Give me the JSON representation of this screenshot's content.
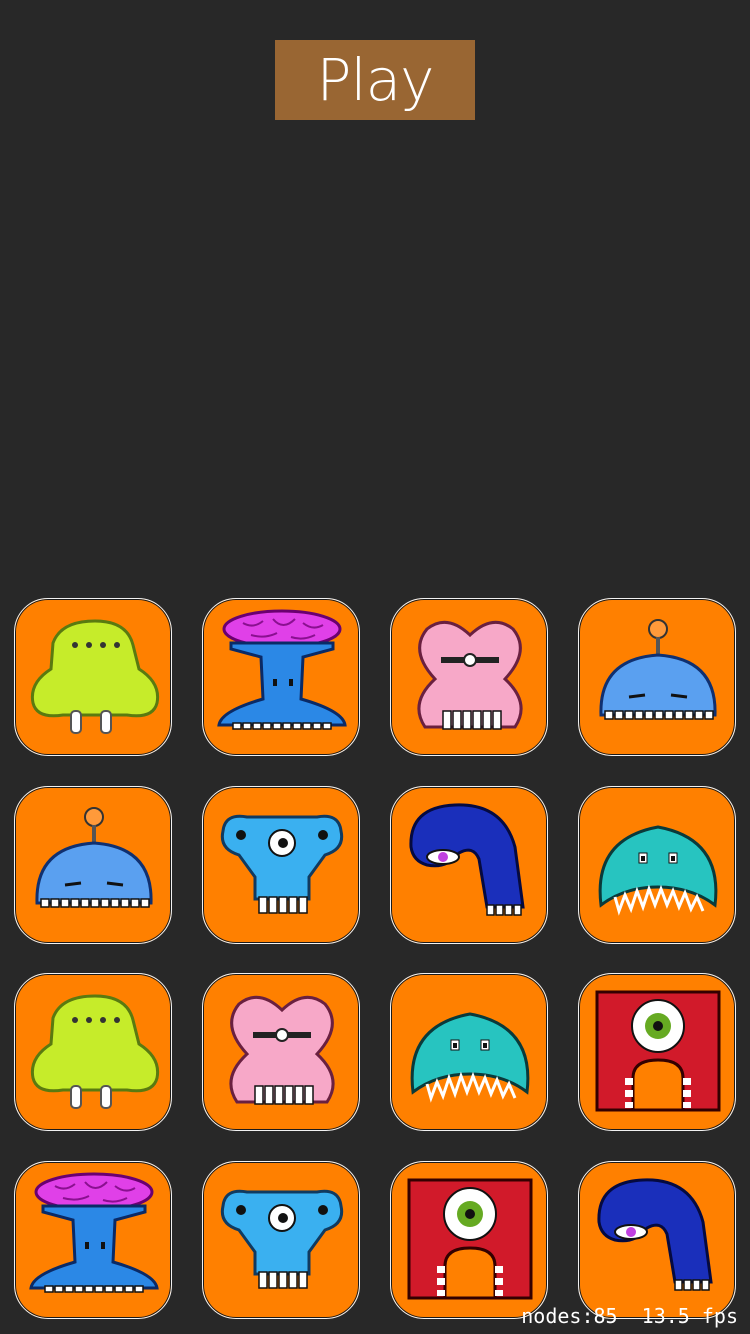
{
  "play_button": {
    "label": "Play"
  },
  "grid": {
    "rows": [
      [
        "green-monster",
        "brain-monster",
        "pink-monster",
        "robot-monster"
      ],
      [
        "robot-monster",
        "skyblue-monster",
        "navy-monster",
        "teal-monster"
      ],
      [
        "green-monster",
        "pink-monster",
        "teal-monster",
        "red-monster"
      ],
      [
        "brain-monster",
        "skyblue-monster",
        "red-monster",
        "navy-monster"
      ]
    ],
    "card_color": "#ff8000"
  },
  "debug": {
    "stats": "nodes:85  13.5 fps"
  },
  "colors": {
    "background": "#282828",
    "play_button": "#996633"
  }
}
